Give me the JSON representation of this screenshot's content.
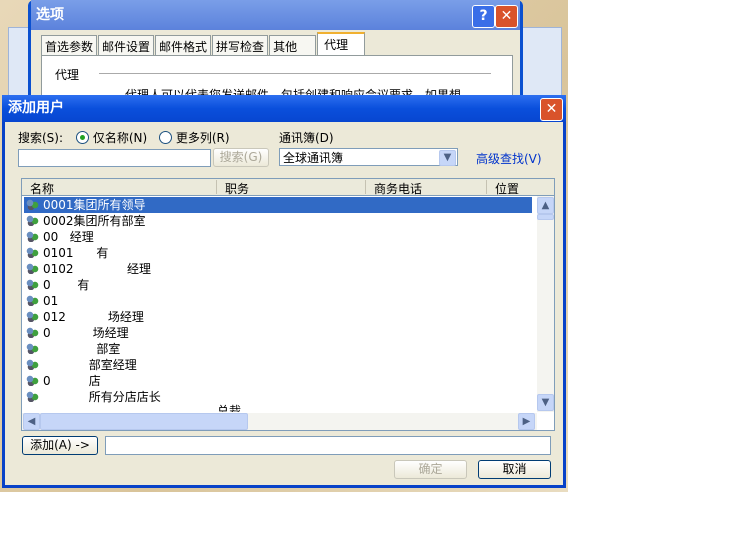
{
  "options_dialog": {
    "title": "选项",
    "help": "?",
    "close": "✕",
    "tabs": [
      "首选参数",
      "邮件设置",
      "邮件格式",
      "拼写检查",
      "其他",
      "代理"
    ],
    "section": "代理",
    "text": "代理人可以代表您发送邮件，包括创建和响应会议要求。如果想"
  },
  "add_user": {
    "title": "添加用户",
    "close": "✕",
    "search_label": "搜索(S):",
    "radio_name": "仅名称(N)",
    "radio_more": "更多列(R)",
    "search_value": "",
    "search_button": "搜索(G)",
    "addressbook_label": "通讯簿(D)",
    "addressbook_value": "全球通讯簿",
    "advanced": "高级查找(V)",
    "columns": [
      "名称",
      "职务",
      "商务电话",
      "位置"
    ],
    "rows": [
      "0001集团所有领导",
      "0002集团所有部室",
      "00   经理",
      "0101      有",
      "0102              经理",
      "0       有",
      "01         ",
      "012           场经理",
      "0           场经理",
      "              部室",
      "            部室经理",
      "0          店",
      "            所有分店店长"
    ],
    "partial_row_title": "总裁",
    "add_button": "添加(A) ->",
    "add_value": "",
    "ok": "确定",
    "cancel": "取消"
  }
}
